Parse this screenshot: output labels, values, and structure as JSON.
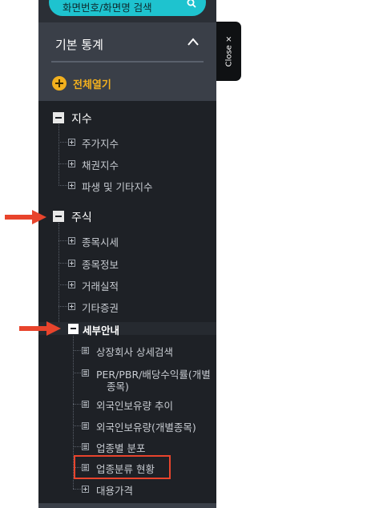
{
  "search": {
    "placeholder": "화면번호/화면명 검색",
    "icon": "search-icon"
  },
  "sidebar": {
    "section_title": "기본 통계",
    "expand_all_label": "전체열기",
    "close_label": "Close ×",
    "tree": {
      "index": {
        "label": "지수",
        "children": [
          "주가지수",
          "채권지수",
          "파생 및 기타지수"
        ]
      },
      "stock": {
        "label": "주식",
        "children": [
          "종목시세",
          "종목정보",
          "거래실적",
          "기타증권"
        ],
        "detail": {
          "label": "세부안내",
          "items": [
            "상장회사 상세검색",
            "PER/PBR/배당수익률(개별",
            "종목)",
            "외국인보유량 추이",
            "외국인보유량(개별종목)",
            "업종별 분포",
            "업종분류 현황"
          ]
        },
        "after": [
          "대용가격"
        ]
      }
    }
  },
  "colors": {
    "accent": "#1ec3cf",
    "sidebar_bg": "#1e2126",
    "highlight": "#e8442c",
    "expand": "#f2b01e"
  }
}
